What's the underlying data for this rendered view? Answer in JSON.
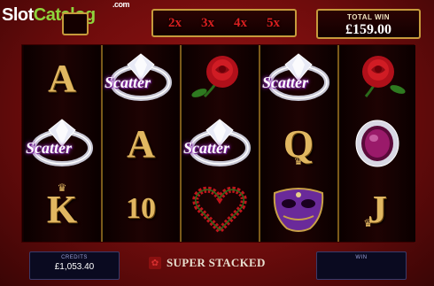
{
  "watermark": {
    "brand_part1": "Slot",
    "brand_part2": "Catalog",
    "domain": ".com"
  },
  "multipliers": [
    "2x",
    "3x",
    "4x",
    "5x"
  ],
  "total_win": {
    "label": "TOTAL WIN",
    "value": "£159.00"
  },
  "reels": [
    [
      "A",
      "Scatter",
      "K"
    ],
    [
      "Scatter",
      "A",
      "10"
    ],
    [
      "rose",
      "Scatter",
      "heart-of-roses"
    ],
    [
      "Scatter",
      "Q",
      "mask"
    ],
    [
      "rose",
      "ruby-ring",
      "J"
    ]
  ],
  "credits": {
    "label": "CREDITS",
    "value": "£1,053.40"
  },
  "win": {
    "label": "WIN",
    "value": ""
  },
  "feature": {
    "label": "SUPER STACKED"
  },
  "colors": {
    "gold": "#c69a3c",
    "multiplier_red": "#d91f1f",
    "background": "#7a0d0d"
  }
}
